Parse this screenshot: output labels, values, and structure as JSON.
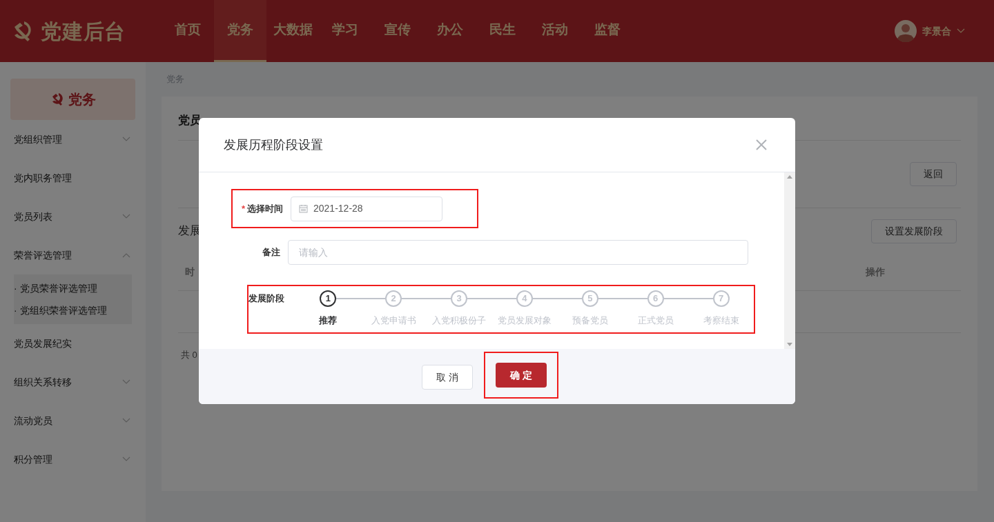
{
  "header": {
    "logo": "党建后台",
    "nav": [
      {
        "label": "首页",
        "selected": false
      },
      {
        "label": "党务",
        "selected": true
      },
      {
        "label": "大数据",
        "selected": false
      },
      {
        "label": "学习",
        "selected": false
      },
      {
        "label": "宣传",
        "selected": false
      },
      {
        "label": "办公",
        "selected": false
      },
      {
        "label": "民生",
        "selected": false
      },
      {
        "label": "活动",
        "selected": false
      },
      {
        "label": "监督",
        "selected": false
      }
    ],
    "user": "李景合"
  },
  "sidebar": {
    "banner": "党务",
    "items": [
      {
        "label": "党组织管理",
        "kind": "group",
        "expanded": false
      },
      {
        "label": "党内职务管理",
        "kind": "link"
      },
      {
        "label": "党员列表",
        "kind": "group",
        "expanded": false
      },
      {
        "label": "荣誉评选管理",
        "kind": "group",
        "expanded": true,
        "children": [
          {
            "label": "· 党员荣誉评选管理"
          },
          {
            "label": "· 党组织荣誉评选管理"
          }
        ]
      },
      {
        "label": "党员发展纪实",
        "kind": "link"
      },
      {
        "label": "组织关系转移",
        "kind": "group",
        "expanded": false
      },
      {
        "label": "流动党员",
        "kind": "group",
        "expanded": false
      },
      {
        "label": "积分管理",
        "kind": "group",
        "expanded": false
      }
    ]
  },
  "breadcrumb": "党务",
  "page": {
    "title": "党员",
    "back_button": "返回",
    "section_title": "发展",
    "set_stage_button": "设置发展阶段",
    "table": {
      "columns": [
        "时",
        "操作"
      ]
    },
    "pagination": "共 0"
  },
  "dialog": {
    "title": "发展历程阶段设置",
    "date_label": "选择时间",
    "date_required_mark": "*",
    "date_value": "2021-12-28",
    "note_label": "备注",
    "note_placeholder": "请输入",
    "stage_label": "发展阶段",
    "steps": [
      {
        "number": "1",
        "label": "推荐",
        "selected": true
      },
      {
        "number": "2",
        "label": "入党申请书",
        "selected": false
      },
      {
        "number": "3",
        "label": "入党积极份子",
        "selected": false
      },
      {
        "number": "4",
        "label": "党员发展对象",
        "selected": false
      },
      {
        "number": "5",
        "label": "预备党员",
        "selected": false
      },
      {
        "number": "6",
        "label": "正式党员",
        "selected": false
      },
      {
        "number": "7",
        "label": "考察结束",
        "selected": false
      }
    ],
    "cancel_button": "取 消",
    "confirm_button": "确 定"
  }
}
